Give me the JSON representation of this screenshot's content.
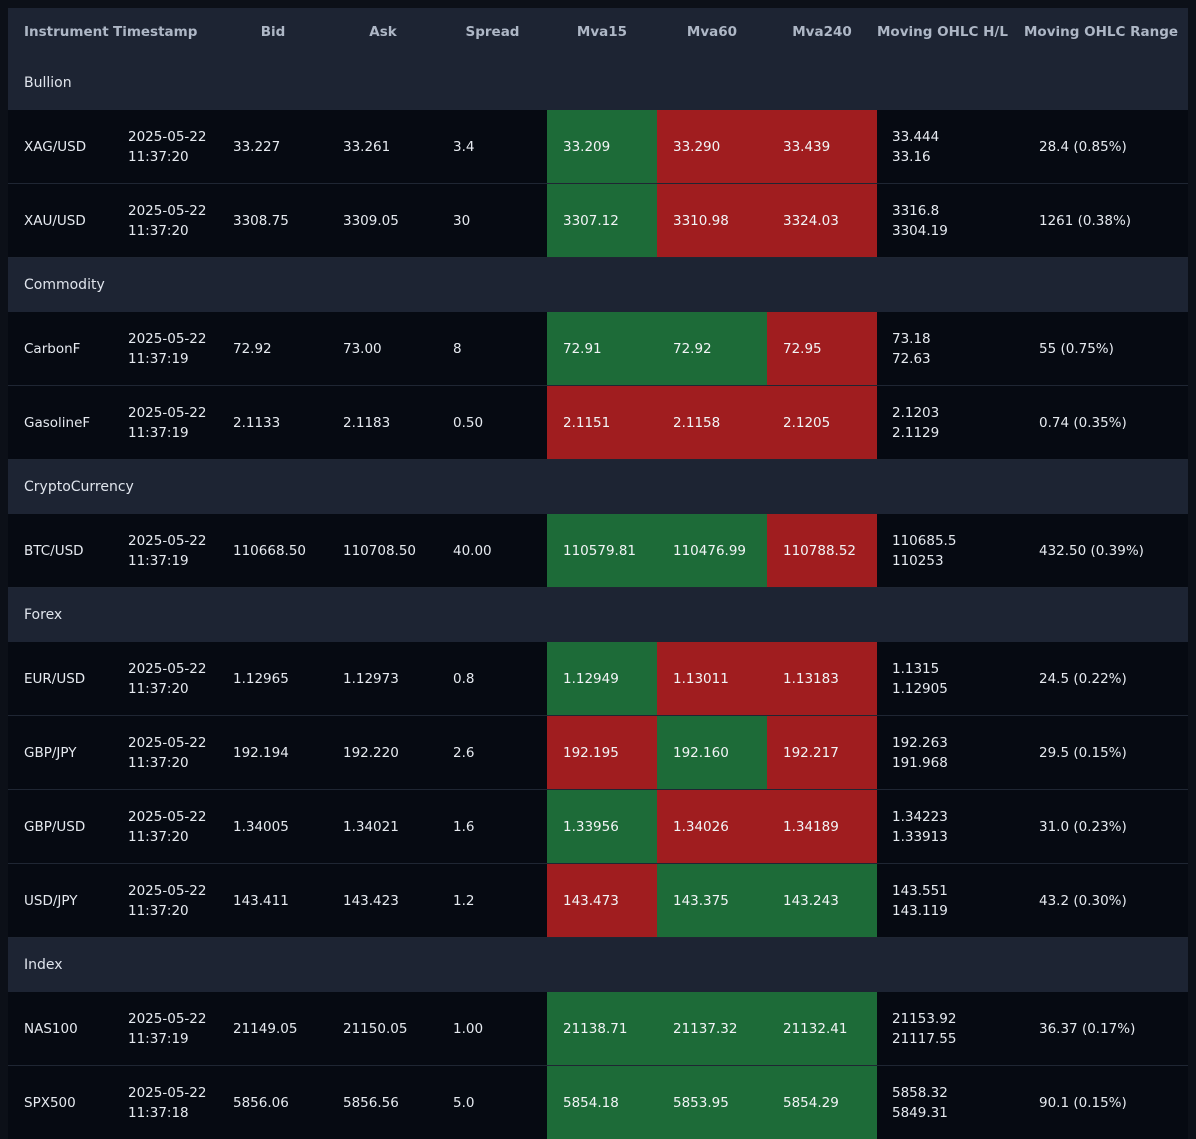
{
  "colors": {
    "background": "#0c1018",
    "header": "#1d2433",
    "row": "#060a12",
    "up": "#1d6b38",
    "down": "#a01d1f"
  },
  "columns": {
    "instrument": "Instrument",
    "timestamp": "Timestamp",
    "bid": "Bid",
    "ask": "Ask",
    "spread": "Spread",
    "mva15": "Mva15",
    "mva60": "Mva60",
    "mva240": "Mva240",
    "hl": "Moving OHLC H/L",
    "range": "Moving OHLC Range"
  },
  "groups": [
    {
      "name": "Bullion",
      "rows": [
        {
          "instrument": "XAG/USD",
          "date": "2025-05-22",
          "time": "11:37:20",
          "bid": "33.227",
          "ask": "33.261",
          "spread": "3.4",
          "mva15": "33.209",
          "mva15_trend": "up",
          "mva60": "33.290",
          "mva60_trend": "down",
          "mva240": "33.439",
          "mva240_trend": "down",
          "high": "33.444",
          "low": "33.16",
          "range": "28.4 (0.85%)"
        },
        {
          "instrument": "XAU/USD",
          "date": "2025-05-22",
          "time": "11:37:20",
          "bid": "3308.75",
          "ask": "3309.05",
          "spread": "30",
          "mva15": "3307.12",
          "mva15_trend": "up",
          "mva60": "3310.98",
          "mva60_trend": "down",
          "mva240": "3324.03",
          "mva240_trend": "down",
          "high": "3316.8",
          "low": "3304.19",
          "range": "1261 (0.38%)"
        }
      ]
    },
    {
      "name": "Commodity",
      "rows": [
        {
          "instrument": "CarbonF",
          "date": "2025-05-22",
          "time": "11:37:19",
          "bid": "72.92",
          "ask": "73.00",
          "spread": "8",
          "mva15": "72.91",
          "mva15_trend": "up",
          "mva60": "72.92",
          "mva60_trend": "up",
          "mva240": "72.95",
          "mva240_trend": "down",
          "high": "73.18",
          "low": "72.63",
          "range": "55 (0.75%)"
        },
        {
          "instrument": "GasolineF",
          "date": "2025-05-22",
          "time": "11:37:19",
          "bid": "2.1133",
          "ask": "2.1183",
          "spread": "0.50",
          "mva15": "2.1151",
          "mva15_trend": "down",
          "mva60": "2.1158",
          "mva60_trend": "down",
          "mva240": "2.1205",
          "mva240_trend": "down",
          "high": "2.1203",
          "low": "2.1129",
          "range": "0.74 (0.35%)"
        }
      ]
    },
    {
      "name": "CryptoCurrency",
      "rows": [
        {
          "instrument": "BTC/USD",
          "date": "2025-05-22",
          "time": "11:37:19",
          "bid": "110668.50",
          "ask": "110708.50",
          "spread": "40.00",
          "mva15": "110579.81",
          "mva15_trend": "up",
          "mva60": "110476.99",
          "mva60_trend": "up",
          "mva240": "110788.52",
          "mva240_trend": "down",
          "high": "110685.5",
          "low": "110253",
          "range": "432.50 (0.39%)"
        }
      ]
    },
    {
      "name": "Forex",
      "rows": [
        {
          "instrument": "EUR/USD",
          "date": "2025-05-22",
          "time": "11:37:20",
          "bid": "1.12965",
          "ask": "1.12973",
          "spread": "0.8",
          "mva15": "1.12949",
          "mva15_trend": "up",
          "mva60": "1.13011",
          "mva60_trend": "down",
          "mva240": "1.13183",
          "mva240_trend": "down",
          "high": "1.1315",
          "low": "1.12905",
          "range": "24.5 (0.22%)"
        },
        {
          "instrument": "GBP/JPY",
          "date": "2025-05-22",
          "time": "11:37:20",
          "bid": "192.194",
          "ask": "192.220",
          "spread": "2.6",
          "mva15": "192.195",
          "mva15_trend": "down",
          "mva60": "192.160",
          "mva60_trend": "up",
          "mva240": "192.217",
          "mva240_trend": "down",
          "high": "192.263",
          "low": "191.968",
          "range": "29.5 (0.15%)"
        },
        {
          "instrument": "GBP/USD",
          "date": "2025-05-22",
          "time": "11:37:20",
          "bid": "1.34005",
          "ask": "1.34021",
          "spread": "1.6",
          "mva15": "1.33956",
          "mva15_trend": "up",
          "mva60": "1.34026",
          "mva60_trend": "down",
          "mva240": "1.34189",
          "mva240_trend": "down",
          "high": "1.34223",
          "low": "1.33913",
          "range": "31.0 (0.23%)"
        },
        {
          "instrument": "USD/JPY",
          "date": "2025-05-22",
          "time": "11:37:20",
          "bid": "143.411",
          "ask": "143.423",
          "spread": "1.2",
          "mva15": "143.473",
          "mva15_trend": "down",
          "mva60": "143.375",
          "mva60_trend": "up",
          "mva240": "143.243",
          "mva240_trend": "up",
          "high": "143.551",
          "low": "143.119",
          "range": "43.2 (0.30%)"
        }
      ]
    },
    {
      "name": "Index",
      "rows": [
        {
          "instrument": "NAS100",
          "date": "2025-05-22",
          "time": "11:37:19",
          "bid": "21149.05",
          "ask": "21150.05",
          "spread": "1.00",
          "mva15": "21138.71",
          "mva15_trend": "up",
          "mva60": "21137.32",
          "mva60_trend": "up",
          "mva240": "21132.41",
          "mva240_trend": "up",
          "high": "21153.92",
          "low": "21117.55",
          "range": "36.37 (0.17%)"
        },
        {
          "instrument": "SPX500",
          "date": "2025-05-22",
          "time": "11:37:18",
          "bid": "5856.06",
          "ask": "5856.56",
          "spread": "5.0",
          "mva15": "5854.18",
          "mva15_trend": "up",
          "mva60": "5853.95",
          "mva60_trend": "up",
          "mva240": "5854.29",
          "mva240_trend": "up",
          "high": "5858.32",
          "low": "5849.31",
          "range": "90.1 (0.15%)"
        }
      ]
    }
  ]
}
